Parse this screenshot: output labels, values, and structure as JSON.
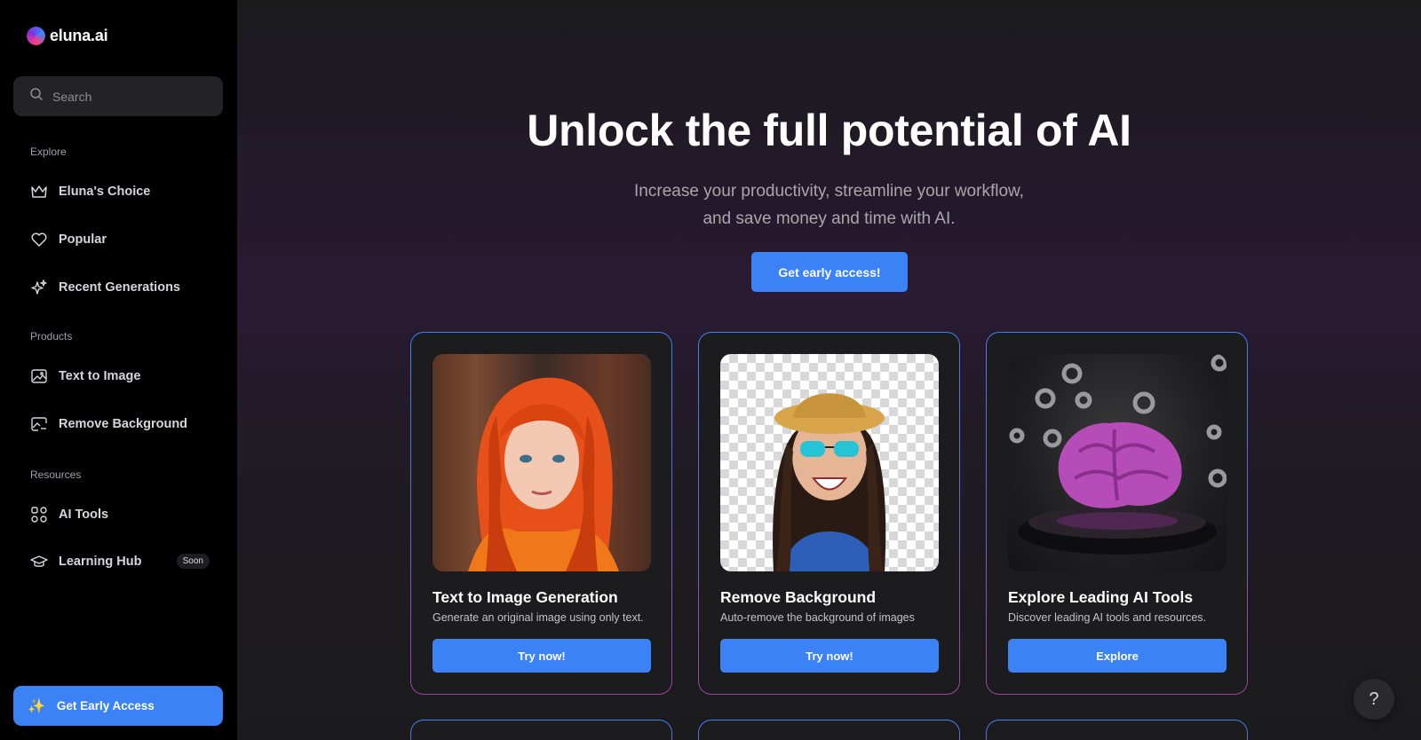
{
  "brand": {
    "name": "eluna.ai"
  },
  "search": {
    "placeholder": "Search"
  },
  "sidebar": {
    "sections": [
      {
        "label": "Explore",
        "items": [
          {
            "label": "Eluna's Choice",
            "icon": "crown-icon"
          },
          {
            "label": "Popular",
            "icon": "heart-icon"
          },
          {
            "label": "Recent Generations",
            "icon": "sparkles-icon"
          }
        ]
      },
      {
        "label": "Products",
        "items": [
          {
            "label": "Text to Image",
            "icon": "image-icon"
          },
          {
            "label": "Remove Background",
            "icon": "image-edit-icon"
          }
        ]
      },
      {
        "label": "Resources",
        "items": [
          {
            "label": "AI Tools",
            "icon": "grid-icon"
          },
          {
            "label": "Learning Hub",
            "icon": "graduation-cap-icon",
            "badge": "Soon"
          }
        ]
      }
    ],
    "cta": {
      "label": "Get Early Access",
      "icon": "sparkle-emoji"
    }
  },
  "hero": {
    "title": "Unlock the full potential of AI",
    "subtitle_line1": "Increase your productivity, streamline your workflow,",
    "subtitle_line2": "and save money and time with AI.",
    "cta": "Get early access!"
  },
  "cards": [
    {
      "title": "Text to Image Generation",
      "desc": "Generate an original image using only text.",
      "button": "Try now!"
    },
    {
      "title": "Remove Background",
      "desc": "Auto-remove the background of images",
      "button": "Try now!"
    },
    {
      "title": "Explore Leading AI Tools",
      "desc": "Discover leading AI tools and resources.",
      "button": "Explore"
    }
  ],
  "help": {
    "label": "?"
  },
  "colors": {
    "accent": "#3b82f6",
    "sidebar_bg": "#000000",
    "main_bg": "#1b1b1d"
  }
}
